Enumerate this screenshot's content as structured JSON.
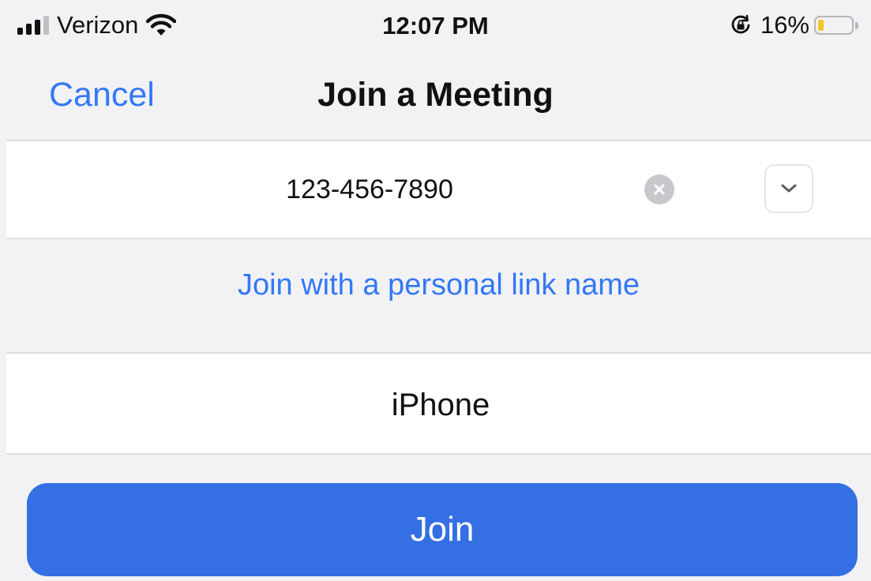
{
  "status_bar": {
    "carrier": "Verizon",
    "time": "12:07 PM",
    "battery_percent": "16%",
    "battery_level": 0.16,
    "signal_bars": 3,
    "signal_max": 4,
    "icons": [
      "signal-icon",
      "wifi-icon",
      "rotation-lock-icon",
      "battery-icon"
    ],
    "battery_color": "#f3c529"
  },
  "nav": {
    "cancel_label": "Cancel",
    "title": "Join a Meeting"
  },
  "meeting_id": {
    "value": "123-456-7890"
  },
  "personal_link": {
    "label": "Join with a personal link name"
  },
  "display_name": {
    "value": "iPhone"
  },
  "join": {
    "label": "Join"
  },
  "colors": {
    "accent": "#3478f6",
    "join_button": "#346fe3",
    "background": "#f2f2f4"
  }
}
